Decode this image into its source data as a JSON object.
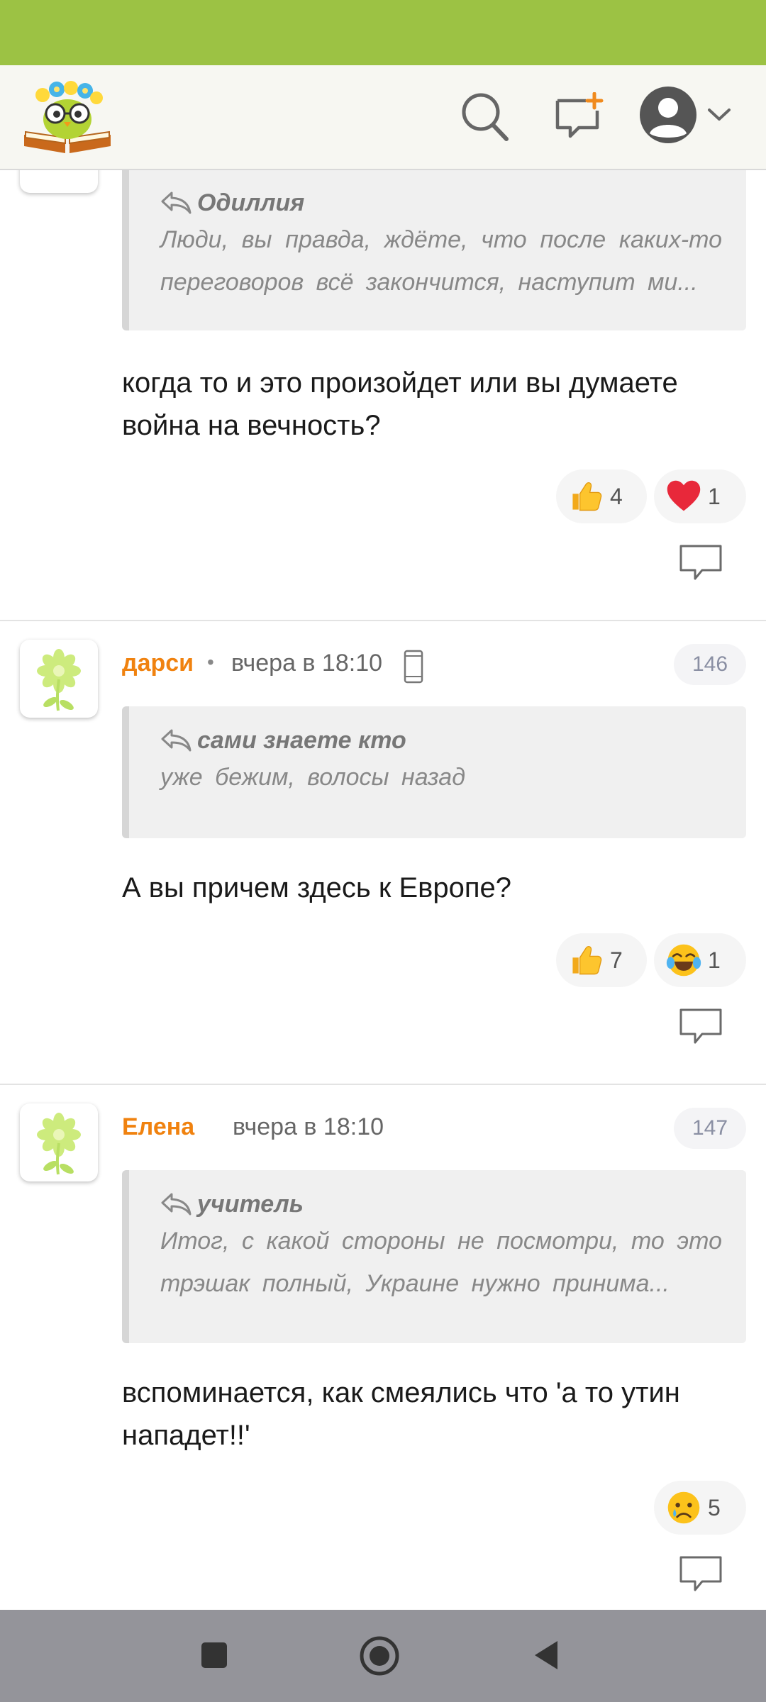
{
  "header": {
    "logo": "reading-owl-logo",
    "icons": [
      "search-icon",
      "new-message-icon",
      "user-avatar-icon",
      "chevron-down-icon"
    ]
  },
  "comments": [
    {
      "quote_author": "Одиллия",
      "quote_text": "Люди, вы правда, ждёте, что после каких-то переговоров всё закончится, наступит ми...",
      "text": "когда то и это произойдет или вы думаете война на вечность?",
      "reactions": [
        {
          "emoji": "thumbs-up",
          "count": "4"
        },
        {
          "emoji": "heart",
          "count": "1"
        }
      ]
    },
    {
      "username": "дарси",
      "separator": "•",
      "time": "вчера в 18:10",
      "device_icon": "phone-icon",
      "number": "146",
      "quote_author": "сами знаете кто",
      "quote_text": "уже бежим, волосы назад",
      "text": "А вы причем здесь к Европе?",
      "reactions": [
        {
          "emoji": "thumbs-up",
          "count": "7"
        },
        {
          "emoji": "tears-of-joy",
          "count": "1"
        }
      ]
    },
    {
      "username": "Елена",
      "time": "вчера в 18:10",
      "number": "147",
      "quote_author": "учитель",
      "quote_text": "Итог, с какой стороны не посмотри, то это трэшак полный, Украине нужно принима...",
      "text": "вспоминается, как смеялись что 'а то утин нападет!!'",
      "reactions": [
        {
          "emoji": "crying-face",
          "count": "5"
        }
      ]
    }
  ],
  "colors": {
    "status_bar": "#9cc244",
    "username": "#f0820f",
    "accent_plus": "#f08a1d"
  },
  "navbar": {
    "icons": [
      "recent-apps-icon",
      "home-icon",
      "back-icon"
    ]
  }
}
